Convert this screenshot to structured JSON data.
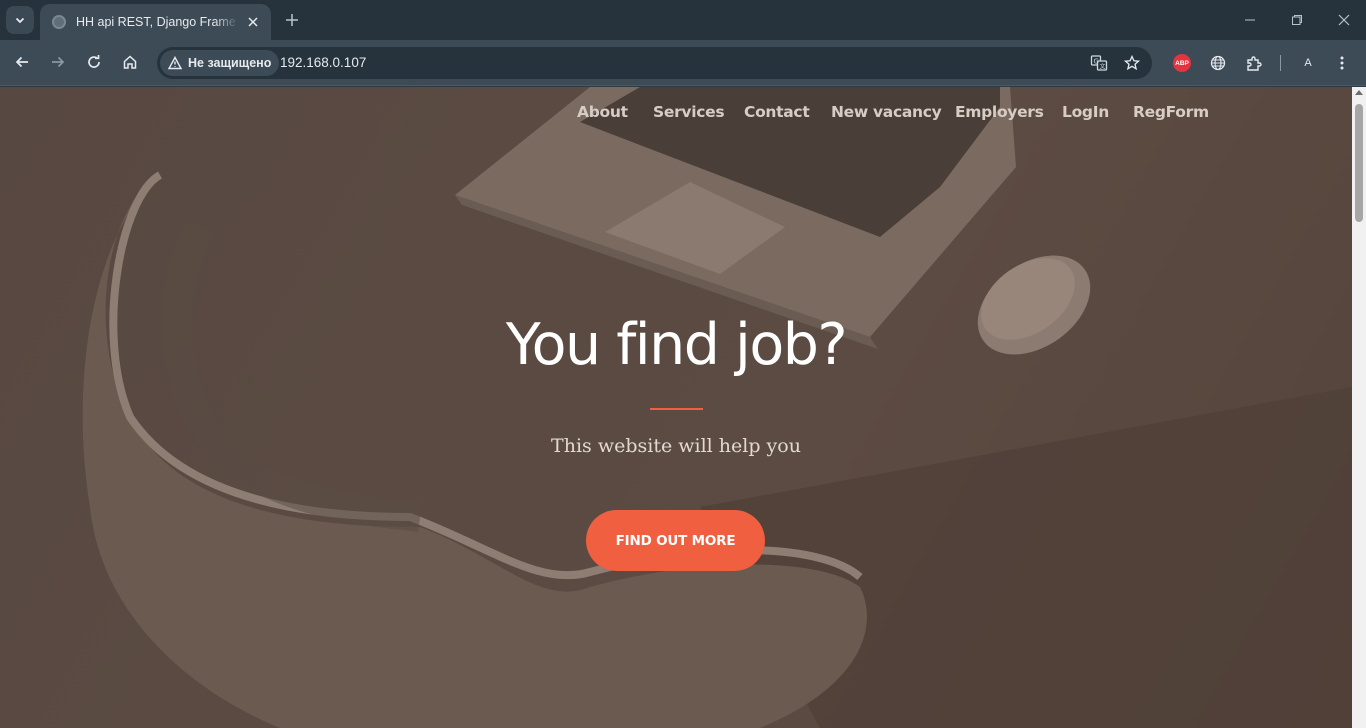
{
  "browser": {
    "tab_title": "HH api REST, Django Frame work",
    "security_label": "Не защищено",
    "url": "192.168.0.107",
    "profile_initial": "A",
    "abp_label": "ABP"
  },
  "nav": {
    "items": [
      {
        "label": "About"
      },
      {
        "label": "Services"
      },
      {
        "label": "Contact"
      },
      {
        "label": "New vacancy"
      },
      {
        "label": "Employers"
      },
      {
        "label": "LogIn"
      },
      {
        "label": "RegForm"
      }
    ]
  },
  "hero": {
    "title": "You find job?",
    "subtitle": "This website will help you",
    "cta_label": "FIND OUT MORE"
  },
  "colors": {
    "accent": "#f05f40",
    "overlay": "#4d3f37"
  }
}
